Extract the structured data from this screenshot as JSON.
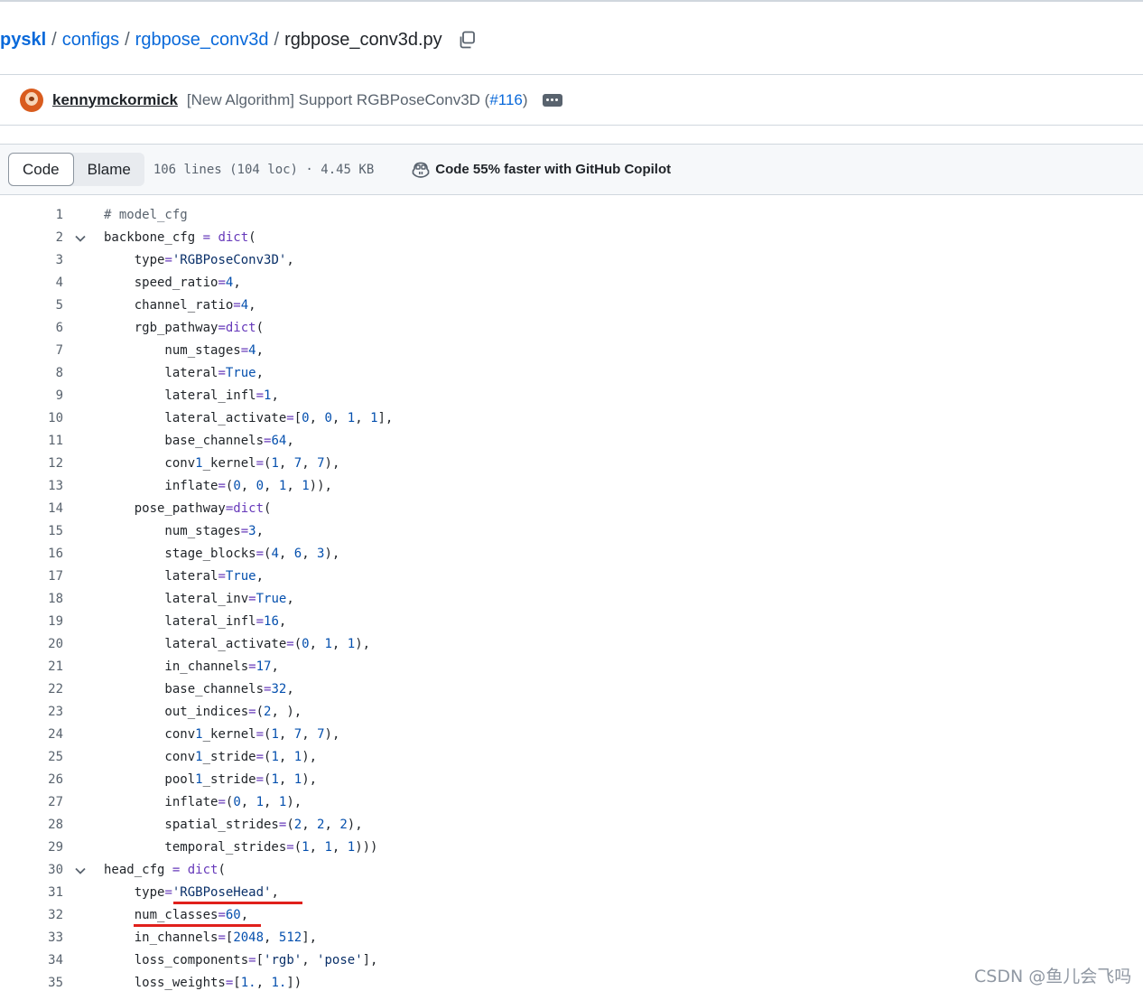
{
  "breadcrumb": {
    "repo": "pyskl",
    "dir1": "configs",
    "dir2": "rgbpose_conv3d",
    "file": "rgbpose_conv3d.py",
    "separator": "/"
  },
  "commit": {
    "author": "kennymckormick",
    "message": "[New Algorithm] Support RGBPoseConv3D (",
    "pr": "#116",
    "message_end": ")"
  },
  "file_header": {
    "tab_code": "Code",
    "tab_blame": "Blame",
    "info": "106 lines (104 loc) · 4.45 KB",
    "copilot": "Code 55% faster with GitHub Copilot"
  },
  "code_lines": [
    {
      "n": "1",
      "text": "# model_cfg",
      "fold": false
    },
    {
      "n": "2",
      "text": "backbone_cfg = dict(",
      "fold": true
    },
    {
      "n": "3",
      "text": "    type='RGBPoseConv3D',",
      "fold": false
    },
    {
      "n": "4",
      "text": "    speed_ratio=4,",
      "fold": false
    },
    {
      "n": "5",
      "text": "    channel_ratio=4,",
      "fold": false
    },
    {
      "n": "6",
      "text": "    rgb_pathway=dict(",
      "fold": false
    },
    {
      "n": "7",
      "text": "        num_stages=4,",
      "fold": false
    },
    {
      "n": "8",
      "text": "        lateral=True,",
      "fold": false
    },
    {
      "n": "9",
      "text": "        lateral_infl=1,",
      "fold": false
    },
    {
      "n": "10",
      "text": "        lateral_activate=[0, 0, 1, 1],",
      "fold": false
    },
    {
      "n": "11",
      "text": "        base_channels=64,",
      "fold": false
    },
    {
      "n": "12",
      "text": "        conv1_kernel=(1, 7, 7),",
      "fold": false
    },
    {
      "n": "13",
      "text": "        inflate=(0, 0, 1, 1)),",
      "fold": false
    },
    {
      "n": "14",
      "text": "    pose_pathway=dict(",
      "fold": false
    },
    {
      "n": "15",
      "text": "        num_stages=3,",
      "fold": false
    },
    {
      "n": "16",
      "text": "        stage_blocks=(4, 6, 3),",
      "fold": false
    },
    {
      "n": "17",
      "text": "        lateral=True,",
      "fold": false
    },
    {
      "n": "18",
      "text": "        lateral_inv=True,",
      "fold": false
    },
    {
      "n": "19",
      "text": "        lateral_infl=16,",
      "fold": false
    },
    {
      "n": "20",
      "text": "        lateral_activate=(0, 1, 1),",
      "fold": false
    },
    {
      "n": "21",
      "text": "        in_channels=17,",
      "fold": false
    },
    {
      "n": "22",
      "text": "        base_channels=32,",
      "fold": false
    },
    {
      "n": "23",
      "text": "        out_indices=(2, ),",
      "fold": false
    },
    {
      "n": "24",
      "text": "        conv1_kernel=(1, 7, 7),",
      "fold": false
    },
    {
      "n": "25",
      "text": "        conv1_stride=(1, 1),",
      "fold": false
    },
    {
      "n": "26",
      "text": "        pool1_stride=(1, 1),",
      "fold": false
    },
    {
      "n": "27",
      "text": "        inflate=(0, 1, 1),",
      "fold": false
    },
    {
      "n": "28",
      "text": "        spatial_strides=(2, 2, 2),",
      "fold": false
    },
    {
      "n": "29",
      "text": "        temporal_strides=(1, 1, 1)))",
      "fold": false
    },
    {
      "n": "30",
      "text": "head_cfg = dict(",
      "fold": true
    },
    {
      "n": "31",
      "text": "    type='RGBPoseHead',",
      "fold": false
    },
    {
      "n": "32",
      "text": "    num_classes=60,",
      "fold": false
    },
    {
      "n": "33",
      "text": "    in_channels=[2048, 512],",
      "fold": false
    },
    {
      "n": "34",
      "text": "    loss_components=['rgb', 'pose'],",
      "fold": false
    },
    {
      "n": "35",
      "text": "    loss_weights=[1., 1.])",
      "fold": false
    }
  ],
  "watermark": "CSDN @鱼儿会飞吗",
  "colors": {
    "link": "#0969da",
    "number": "#0550ae",
    "string": "#0a3069",
    "function": "#6639ba",
    "annotation_underline": "#e0201b"
  },
  "icons": [
    "copy-icon",
    "ellipsis-icon",
    "copilot-icon",
    "chevron-down-icon"
  ]
}
